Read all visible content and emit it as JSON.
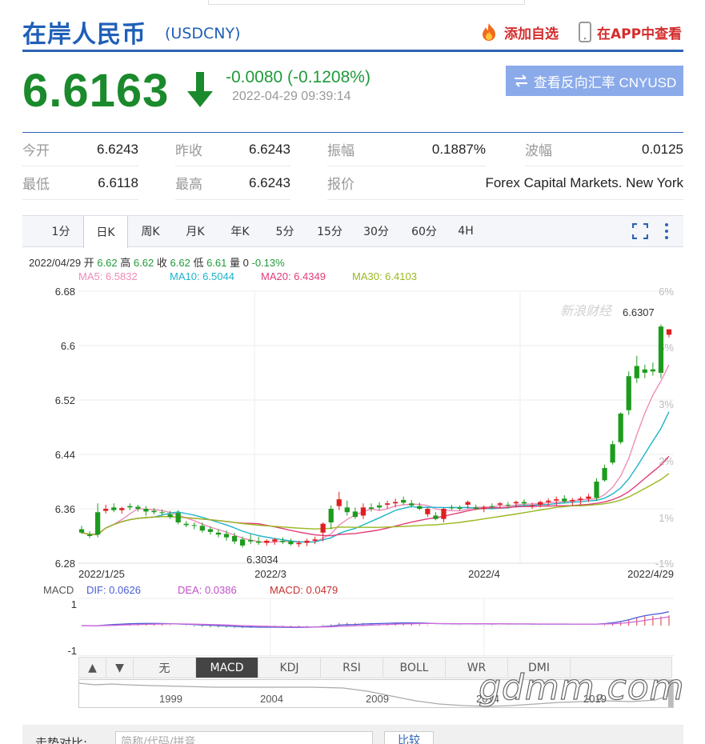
{
  "header": {
    "title": "在岸人民币",
    "code": "(USDCNY)",
    "add_watch": "添加自选",
    "view_app": "在APP中查看"
  },
  "quote": {
    "price": "6.6163",
    "change": "-0.0080 (-0.1208%)",
    "time": "2022-04-29 09:39:14",
    "reverse_btn": "查看反向汇率 CNYUSD"
  },
  "stats": [
    {
      "label": "今开",
      "value": "6.6243"
    },
    {
      "label": "昨收",
      "value": "6.6243"
    },
    {
      "label": "振幅",
      "value": "0.1887%"
    },
    {
      "label": "波幅",
      "value": "0.0125"
    },
    {
      "label": "最低",
      "value": "6.6118"
    },
    {
      "label": "最高",
      "value": "6.6243"
    },
    {
      "label": "报价",
      "value": "Forex Capital Markets. New York"
    }
  ],
  "tabs": [
    "1分",
    "日K",
    "周K",
    "月K",
    "年K",
    "5分",
    "15分",
    "30分",
    "60分",
    "4H"
  ],
  "active_tab": "日K",
  "info": {
    "date": "2022/04/29",
    "open_lbl": "开",
    "open": "6.62",
    "high_lbl": "高",
    "high": "6.62",
    "close_lbl": "收",
    "close": "6.62",
    "low_lbl": "低",
    "low": "6.61",
    "vol_lbl": "量",
    "vol": "0",
    "pct": "-0.13%"
  },
  "ma": [
    {
      "label": "MA5: 6.5832",
      "color": "#f08cb8"
    },
    {
      "label": "MA10: 6.5044",
      "color": "#1eb3cc"
    },
    {
      "label": "MA20: 6.4349",
      "color": "#e03c78"
    },
    {
      "label": "MA30: 6.4103",
      "color": "#9ab820"
    }
  ],
  "chart_data": {
    "type": "candlestick",
    "y_ticks": [
      "6.68",
      "6.6",
      "6.52",
      "6.44",
      "6.36",
      "6.28"
    ],
    "pct_ticks": [
      "6%",
      "5%",
      "4%",
      "3%",
      "2%",
      "1%",
      "-1%"
    ],
    "x_labels": [
      "2022/1/25",
      "2022/3",
      "2022/4",
      "2022/4/29"
    ],
    "ylim": [
      6.28,
      6.68
    ],
    "annotations": {
      "low": "6.3034",
      "high": "6.6307"
    },
    "watermark": "新浪财经",
    "macd_label": "MACD",
    "dif": "DIF: 0.0626",
    "dea": "DEA: 0.0386",
    "macd": "MACD: 0.0479",
    "macd_ticks": [
      "1",
      "-1"
    ],
    "candles": [
      [
        6.33,
        6.335,
        6.323,
        6.325
      ],
      [
        6.322,
        6.327,
        6.317,
        6.32
      ],
      [
        6.355,
        6.368,
        6.318,
        6.322
      ],
      [
        6.357,
        6.366,
        6.353,
        6.36
      ],
      [
        6.362,
        6.368,
        6.355,
        6.358
      ],
      [
        6.358,
        6.363,
        6.353,
        6.361
      ],
      [
        6.364,
        6.368,
        6.358,
        6.362
      ],
      [
        6.363,
        6.366,
        6.356,
        6.36
      ],
      [
        6.36,
        6.364,
        6.35,
        6.356
      ],
      [
        6.357,
        6.361,
        6.352,
        6.355
      ],
      [
        6.355,
        6.359,
        6.35,
        6.354
      ],
      [
        6.352,
        6.357,
        6.345,
        6.348
      ],
      [
        6.354,
        6.358,
        6.337,
        6.34
      ],
      [
        6.338,
        6.342,
        6.333,
        6.336
      ],
      [
        6.336,
        6.34,
        6.33,
        6.335
      ],
      [
        6.335,
        6.34,
        6.325,
        6.328
      ],
      [
        6.33,
        6.334,
        6.322,
        6.326
      ],
      [
        6.325,
        6.33,
        6.318,
        6.322
      ],
      [
        6.323,
        6.328,
        6.313,
        6.318
      ],
      [
        6.32,
        6.325,
        6.308,
        6.312
      ],
      [
        6.315,
        6.319,
        6.303,
        6.306
      ],
      [
        6.314,
        6.323,
        6.308,
        6.312
      ],
      [
        6.312,
        6.319,
        6.307,
        6.31
      ],
      [
        6.31,
        6.315,
        6.306,
        6.313
      ],
      [
        6.312,
        6.317,
        6.307,
        6.315
      ],
      [
        6.313,
        6.318,
        6.308,
        6.311
      ],
      [
        6.312,
        6.316,
        6.306,
        6.308
      ],
      [
        6.308,
        6.313,
        6.304,
        6.31
      ],
      [
        6.31,
        6.316,
        6.305,
        6.313
      ],
      [
        6.313,
        6.319,
        6.308,
        6.315
      ],
      [
        6.325,
        6.34,
        6.312,
        6.338
      ],
      [
        6.36,
        6.365,
        6.33,
        6.34
      ],
      [
        6.364,
        6.385,
        6.358,
        6.374
      ],
      [
        6.362,
        6.372,
        6.35,
        6.355
      ],
      [
        6.356,
        6.362,
        6.345,
        6.348
      ],
      [
        6.35,
        6.368,
        6.345,
        6.362
      ],
      [
        6.362,
        6.368,
        6.356,
        6.36
      ],
      [
        6.365,
        6.37,
        6.358,
        6.362
      ],
      [
        6.366,
        6.372,
        6.36,
        6.368
      ],
      [
        6.368,
        6.375,
        6.362,
        6.37
      ],
      [
        6.373,
        6.378,
        6.366,
        6.369
      ],
      [
        6.368,
        6.373,
        6.362,
        6.365
      ],
      [
        6.364,
        6.369,
        6.358,
        6.36
      ],
      [
        6.352,
        6.362,
        6.348,
        6.36
      ],
      [
        6.35,
        6.355,
        6.343,
        6.345
      ],
      [
        6.345,
        6.362,
        6.34,
        6.36
      ],
      [
        6.362,
        6.366,
        6.358,
        6.361
      ],
      [
        6.362,
        6.365,
        6.357,
        6.36
      ],
      [
        6.366,
        6.372,
        6.36,
        6.37
      ],
      [
        6.362,
        6.366,
        6.358,
        6.36
      ],
      [
        6.36,
        6.365,
        6.355,
        6.362
      ],
      [
        6.364,
        6.368,
        6.36,
        6.363
      ],
      [
        6.366,
        6.37,
        6.36,
        6.368
      ],
      [
        6.366,
        6.37,
        6.361,
        6.365
      ],
      [
        6.368,
        6.372,
        6.362,
        6.37
      ],
      [
        6.37,
        6.374,
        6.364,
        6.368
      ],
      [
        6.364,
        6.369,
        6.36,
        6.365
      ],
      [
        6.366,
        6.372,
        6.362,
        6.37
      ],
      [
        6.37,
        6.375,
        6.364,
        6.372
      ],
      [
        6.372,
        6.378,
        6.365,
        6.374
      ],
      [
        6.375,
        6.38,
        6.368,
        6.371
      ],
      [
        6.371,
        6.376,
        6.364,
        6.373
      ],
      [
        6.373,
        6.378,
        6.366,
        6.375
      ],
      [
        6.375,
        6.382,
        6.37,
        6.378
      ],
      [
        6.4,
        6.405,
        6.372,
        6.376
      ],
      [
        6.42,
        6.425,
        6.4,
        6.402
      ],
      [
        6.455,
        6.46,
        6.425,
        6.428
      ],
      [
        6.5,
        6.502,
        6.455,
        6.458
      ],
      [
        6.555,
        6.562,
        6.498,
        6.505
      ],
      [
        6.57,
        6.585,
        6.545,
        6.552
      ],
      [
        6.565,
        6.572,
        6.552,
        6.56
      ],
      [
        6.565,
        6.575,
        6.556,
        6.562
      ],
      [
        6.628,
        6.631,
        6.552,
        6.56
      ],
      [
        6.616,
        6.624,
        6.612,
        6.624
      ]
    ]
  },
  "indicators": [
    "▲",
    "▼",
    "无",
    "MACD",
    "KDJ",
    "RSI",
    "BOLL",
    "WR",
    "DMI"
  ],
  "active_indicator": "MACD",
  "navigator": {
    "years": [
      "1999",
      "2004",
      "2009",
      "2014",
      "2019"
    ]
  },
  "compare": {
    "label": "走势对比:",
    "placeholder": "简称/代码/拼音",
    "button": "比较"
  },
  "watermark_site": "gdmm.com"
}
